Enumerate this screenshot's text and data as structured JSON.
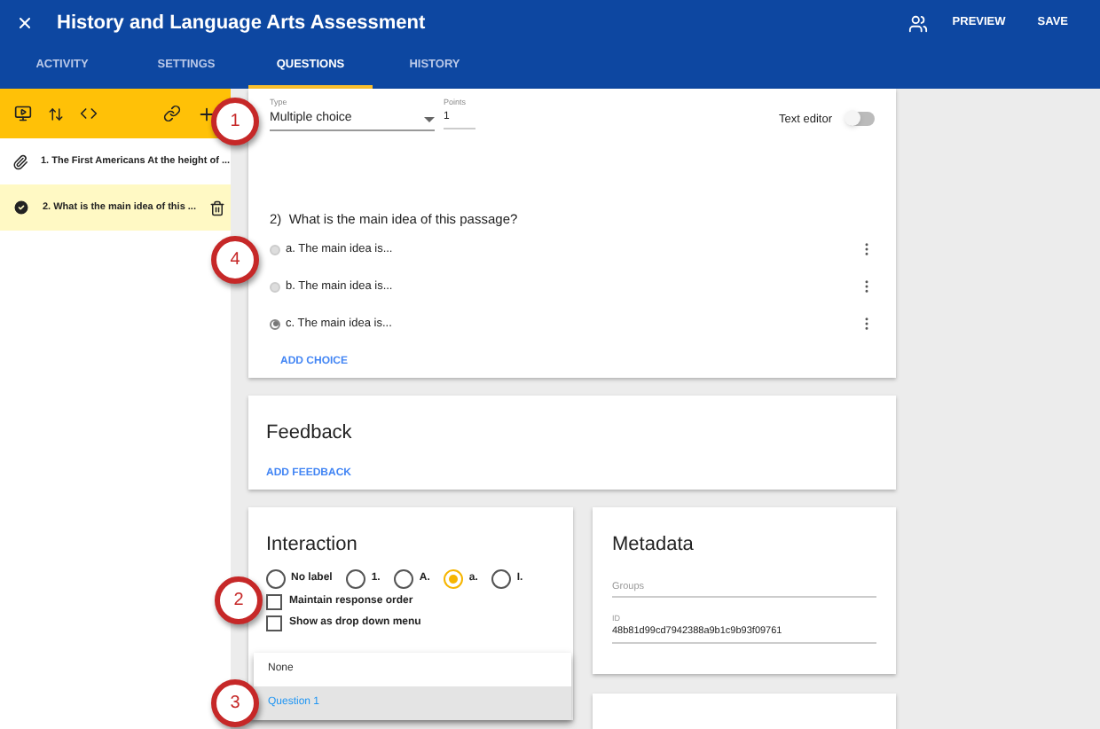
{
  "header": {
    "title": "History and Language Arts Assessment",
    "actions": [
      {
        "label": "PREVIEW"
      },
      {
        "label": "SAVE"
      }
    ]
  },
  "tabs": [
    {
      "label": "ACTIVITY",
      "selected": false
    },
    {
      "label": "SETTINGS",
      "selected": false
    },
    {
      "label": "QUESTIONS",
      "selected": true
    },
    {
      "label": "HISTORY",
      "selected": false
    }
  ],
  "sidebar": {
    "items": [
      {
        "text": "1. The First Americans At the height of ...",
        "kind": "attachment",
        "selected": false
      },
      {
        "text": "2. What is the main idea of this ...",
        "kind": "question",
        "selected": true
      }
    ]
  },
  "question": {
    "type_label": "Type",
    "type_value": "Multiple choice",
    "points_label": "Points",
    "points_value": "1",
    "text_editor": {
      "label": "Text editor",
      "on": false
    },
    "number": "2)",
    "prompt": "What is the main idea of this passage?",
    "choices": [
      {
        "letter": "a.",
        "text": "The main idea is...",
        "selected": false
      },
      {
        "letter": "b.",
        "text": "The main idea is...",
        "selected": false
      },
      {
        "letter": "c.",
        "text": "The main idea is...",
        "selected": true
      }
    ],
    "add_choice": "ADD CHOICE"
  },
  "feedback": {
    "title": "Feedback",
    "add": "ADD FEEDBACK"
  },
  "interaction": {
    "title": "Interaction",
    "label_options": [
      {
        "label": "No label",
        "selected": false
      },
      {
        "label": "1.",
        "selected": false
      },
      {
        "label": "A.",
        "selected": false
      },
      {
        "label": "a.",
        "selected": true
      },
      {
        "label": "I.",
        "selected": false
      }
    ],
    "checkboxes": [
      {
        "label": "Maintain response order",
        "checked": false
      },
      {
        "label": "Show as drop down menu",
        "checked": false
      }
    ]
  },
  "dropdown": {
    "items": [
      {
        "label": "None",
        "selected": false
      },
      {
        "label": "Question 1",
        "selected": true
      }
    ]
  },
  "metadata": {
    "title": "Metadata",
    "groups_placeholder": "Groups",
    "id_label": "ID",
    "id_value": "48b81d99cd7942388a9b1c9b93f09761"
  },
  "callouts": [
    {
      "number": "1"
    },
    {
      "number": "4"
    },
    {
      "number": "2"
    },
    {
      "number": "3"
    }
  ]
}
